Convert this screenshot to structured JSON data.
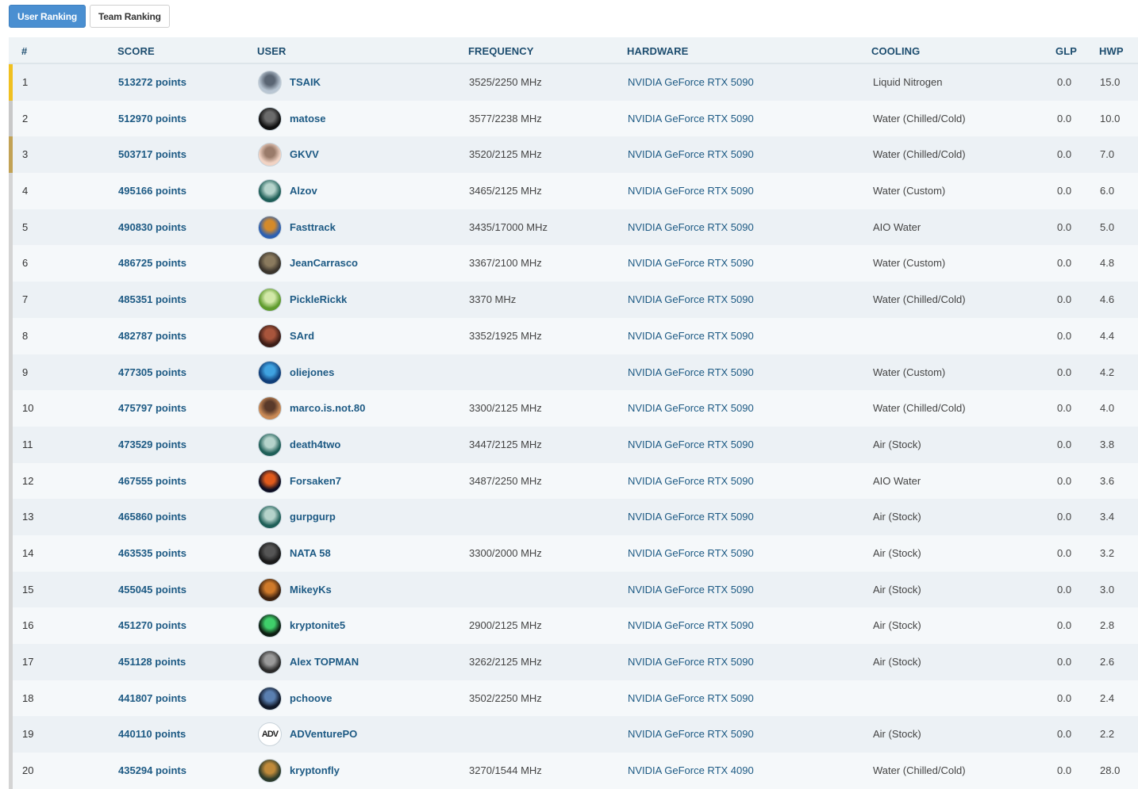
{
  "tabs": {
    "user_ranking": "User Ranking",
    "team_ranking": "Team Ranking"
  },
  "columns": {
    "rank": "#",
    "score": "SCORE",
    "user": "USER",
    "frequency": "FREQUENCY",
    "hardware": "HARDWARE",
    "cooling": "COOLING",
    "glp": "GLP",
    "hwp": "HWP"
  },
  "colors": {
    "gold": "#f0c020",
    "silver": "#c8c8c8",
    "bronze": "#c2a255",
    "default": "#d4d4d4",
    "link": "#1d5a84"
  },
  "rows": [
    {
      "rank": "1",
      "score": "513272 points",
      "user": "TSAIK",
      "frequency": "3525/2250 MHz",
      "hardware": "NVIDIA GeForce RTX 5090",
      "cooling": "Liquid Nitrogen",
      "glp": "0.0",
      "hwp": "15.0",
      "medal": "gold",
      "avatar_colors": [
        "#b9c6d3",
        "#5a6573"
      ]
    },
    {
      "rank": "2",
      "score": "512970 points",
      "user": "matose",
      "frequency": "3577/2238 MHz",
      "hardware": "NVIDIA GeForce RTX 5090",
      "cooling": "Water (Chilled/Cold)",
      "glp": "0.0",
      "hwp": "10.0",
      "medal": "silver",
      "avatar_colors": [
        "#101010",
        "#6b6b6b"
      ]
    },
    {
      "rank": "3",
      "score": "503717 points",
      "user": "GKVV",
      "frequency": "3520/2125 MHz",
      "hardware": "NVIDIA GeForce RTX 5090",
      "cooling": "Water (Chilled/Cold)",
      "glp": "0.0",
      "hwp": "7.0",
      "medal": "bronze",
      "avatar_colors": [
        "#f1d3c4",
        "#9a7b6a"
      ]
    },
    {
      "rank": "4",
      "score": "495166 points",
      "user": "Alzov",
      "frequency": "3465/2125 MHz",
      "hardware": "NVIDIA GeForce RTX 5090",
      "cooling": "Water (Custom)",
      "glp": "0.0",
      "hwp": "6.0",
      "medal": "default",
      "avatar_colors": [
        "#1e5e57",
        "#b5d3cb"
      ]
    },
    {
      "rank": "5",
      "score": "490830 points",
      "user": "Fasttrack",
      "frequency": "3435/17000 MHz",
      "hardware": "NVIDIA GeForce RTX 5090",
      "cooling": "AIO Water",
      "glp": "0.0",
      "hwp": "5.0",
      "medal": "default",
      "avatar_colors": [
        "#2b5fb2",
        "#d48a2a"
      ]
    },
    {
      "rank": "6",
      "score": "486725 points",
      "user": "JeanCarrasco",
      "frequency": "3367/2100 MHz",
      "hardware": "NVIDIA GeForce RTX 5090",
      "cooling": "Water (Custom)",
      "glp": "0.0",
      "hwp": "4.8",
      "medal": "default",
      "avatar_colors": [
        "#3a342c",
        "#8a7a5e"
      ]
    },
    {
      "rank": "7",
      "score": "485351 points",
      "user": "PickleRickk",
      "frequency": "3370 MHz",
      "hardware": "NVIDIA GeForce RTX 5090",
      "cooling": "Water (Chilled/Cold)",
      "glp": "0.0",
      "hwp": "4.6",
      "medal": "default",
      "avatar_colors": [
        "#5f9b2d",
        "#d2e8a8"
      ]
    },
    {
      "rank": "8",
      "score": "482787 points",
      "user": "SArd",
      "frequency": "3352/1925 MHz",
      "hardware": "NVIDIA GeForce RTX 5090",
      "cooling": "",
      "glp": "0.0",
      "hwp": "4.4",
      "medal": "default",
      "avatar_colors": [
        "#3c1d16",
        "#a8553c"
      ]
    },
    {
      "rank": "9",
      "score": "477305 points",
      "user": "oliejones",
      "frequency": "",
      "hardware": "NVIDIA GeForce RTX 5090",
      "cooling": "Water (Custom)",
      "glp": "0.0",
      "hwp": "4.2",
      "medal": "default",
      "avatar_colors": [
        "#0f3d78",
        "#3fa2e0"
      ]
    },
    {
      "rank": "10",
      "score": "475797 points",
      "user": "marco.is.not.80",
      "frequency": "3300/2125 MHz",
      "hardware": "NVIDIA GeForce RTX 5090",
      "cooling": "Water (Chilled/Cold)",
      "glp": "0.0",
      "hwp": "4.0",
      "medal": "default",
      "avatar_colors": [
        "#c98a56",
        "#5a3a2a"
      ]
    },
    {
      "rank": "11",
      "score": "473529 points",
      "user": "death4two",
      "frequency": "3447/2125 MHz",
      "hardware": "NVIDIA GeForce RTX 5090",
      "cooling": "Air (Stock)",
      "glp": "0.0",
      "hwp": "3.8",
      "medal": "default",
      "avatar_colors": [
        "#1e5e57",
        "#b5d3cb"
      ]
    },
    {
      "rank": "12",
      "score": "467555 points",
      "user": "Forsaken7",
      "frequency": "3487/2250 MHz",
      "hardware": "NVIDIA GeForce RTX 5090",
      "cooling": "AIO Water",
      "glp": "0.0",
      "hwp": "3.6",
      "medal": "default",
      "avatar_colors": [
        "#0d0d22",
        "#e05a1c"
      ]
    },
    {
      "rank": "13",
      "score": "465860 points",
      "user": "gurpgurp",
      "frequency": "",
      "hardware": "NVIDIA GeForce RTX 5090",
      "cooling": "Air (Stock)",
      "glp": "0.0",
      "hwp": "3.4",
      "medal": "default",
      "avatar_colors": [
        "#1e5e57",
        "#b5d3cb"
      ]
    },
    {
      "rank": "14",
      "score": "463535 points",
      "user": "NATA 58",
      "frequency": "3300/2000 MHz",
      "hardware": "NVIDIA GeForce RTX 5090",
      "cooling": "Air (Stock)",
      "glp": "0.0",
      "hwp": "3.2",
      "medal": "default",
      "avatar_colors": [
        "#1a1a1a",
        "#555555"
      ]
    },
    {
      "rank": "15",
      "score": "455045 points",
      "user": "MikeyKs",
      "frequency": "",
      "hardware": "NVIDIA GeForce RTX 5090",
      "cooling": "Air (Stock)",
      "glp": "0.0",
      "hwp": "3.0",
      "medal": "default",
      "avatar_colors": [
        "#3d2210",
        "#d07a2a"
      ]
    },
    {
      "rank": "16",
      "score": "451270 points",
      "user": "kryptonite5",
      "frequency": "2900/2125 MHz",
      "hardware": "NVIDIA GeForce RTX 5090",
      "cooling": "Air (Stock)",
      "glp": "0.0",
      "hwp": "2.8",
      "medal": "default",
      "avatar_colors": [
        "#0d1e12",
        "#3fcf6a"
      ]
    },
    {
      "rank": "17",
      "score": "451128 points",
      "user": "Alex TOPMAN",
      "frequency": "3262/2125 MHz",
      "hardware": "NVIDIA GeForce RTX 5090",
      "cooling": "Air (Stock)",
      "glp": "0.0",
      "hwp": "2.6",
      "medal": "default",
      "avatar_colors": [
        "#2a2a2a",
        "#9a9a9a"
      ]
    },
    {
      "rank": "18",
      "score": "441807 points",
      "user": "pchoove",
      "frequency": "3502/2250 MHz",
      "hardware": "NVIDIA GeForce RTX 5090",
      "cooling": "",
      "glp": "0.0",
      "hwp": "2.4",
      "medal": "default",
      "avatar_colors": [
        "#101828",
        "#5a7fb0"
      ]
    },
    {
      "rank": "19",
      "score": "440110 points",
      "user": "ADVenturePO",
      "frequency": "",
      "hardware": "NVIDIA GeForce RTX 5090",
      "cooling": "Air (Stock)",
      "glp": "0.0",
      "hwp": "2.2",
      "medal": "default",
      "avatar_colors": [
        "#ffffff",
        "#222222"
      ],
      "avatar_text": "ADV"
    },
    {
      "rank": "20",
      "score": "435294 points",
      "user": "kryptonfly",
      "frequency": "3270/1544 MHz",
      "hardware": "NVIDIA GeForce RTX 4090",
      "cooling": "Water (Chilled/Cold)",
      "glp": "0.0",
      "hwp": "28.0",
      "medal": "default",
      "avatar_colors": [
        "#2b3a2a",
        "#c08a3a"
      ]
    }
  ]
}
